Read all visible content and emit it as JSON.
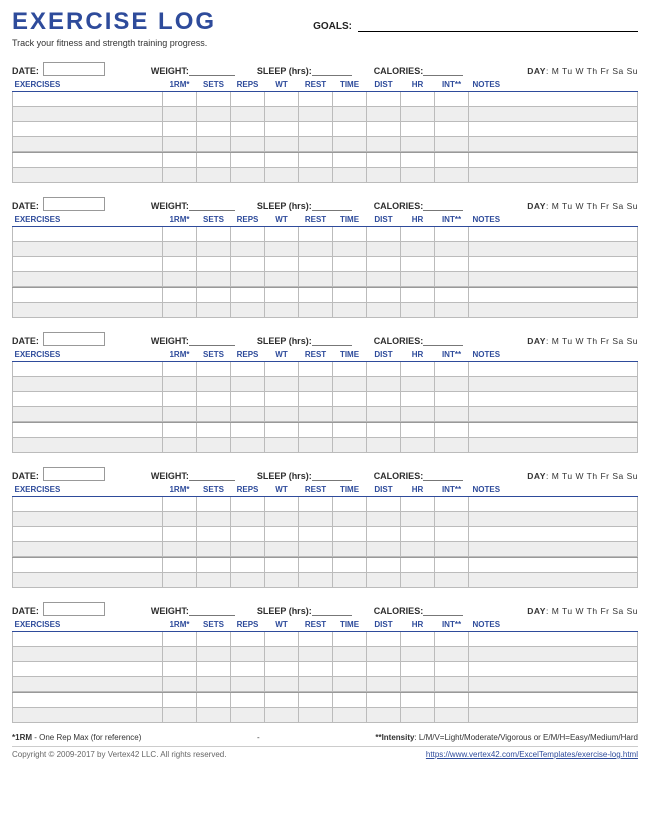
{
  "header": {
    "title": "EXERCISE LOG",
    "subtitle": "Track your fitness and strength training progress.",
    "goals_label": "GOALS:"
  },
  "blockLabels": {
    "date": "DATE:",
    "weight": "WEIGHT:",
    "sleep": "SLEEP (hrs):",
    "calories": "CALORIES:",
    "day": "DAY",
    "days": "M Tu W Th Fr Sa Su"
  },
  "columns": {
    "exercises": "EXERCISES",
    "rm": "1RM*",
    "sets": "SETS",
    "reps": "REPS",
    "wt": "WT",
    "rest": "REST",
    "time": "TIME",
    "dist": "DIST",
    "hr": "HR",
    "int": "INT**",
    "notes": "NOTES"
  },
  "footnotes": {
    "rm": "*1RM - One Rep Max (for reference)",
    "dash": "-",
    "intensity": "**Intensity: L/M/V=Light/Moderate/Vigorous or E/M/H=Easy/Medium/Hard"
  },
  "footer": {
    "copyright": "Copyright © 2009-2017 by Vertex42 LLC. All rights reserved.",
    "url": "https://www.vertex42.com/ExcelTemplates/exercise-log.html"
  }
}
